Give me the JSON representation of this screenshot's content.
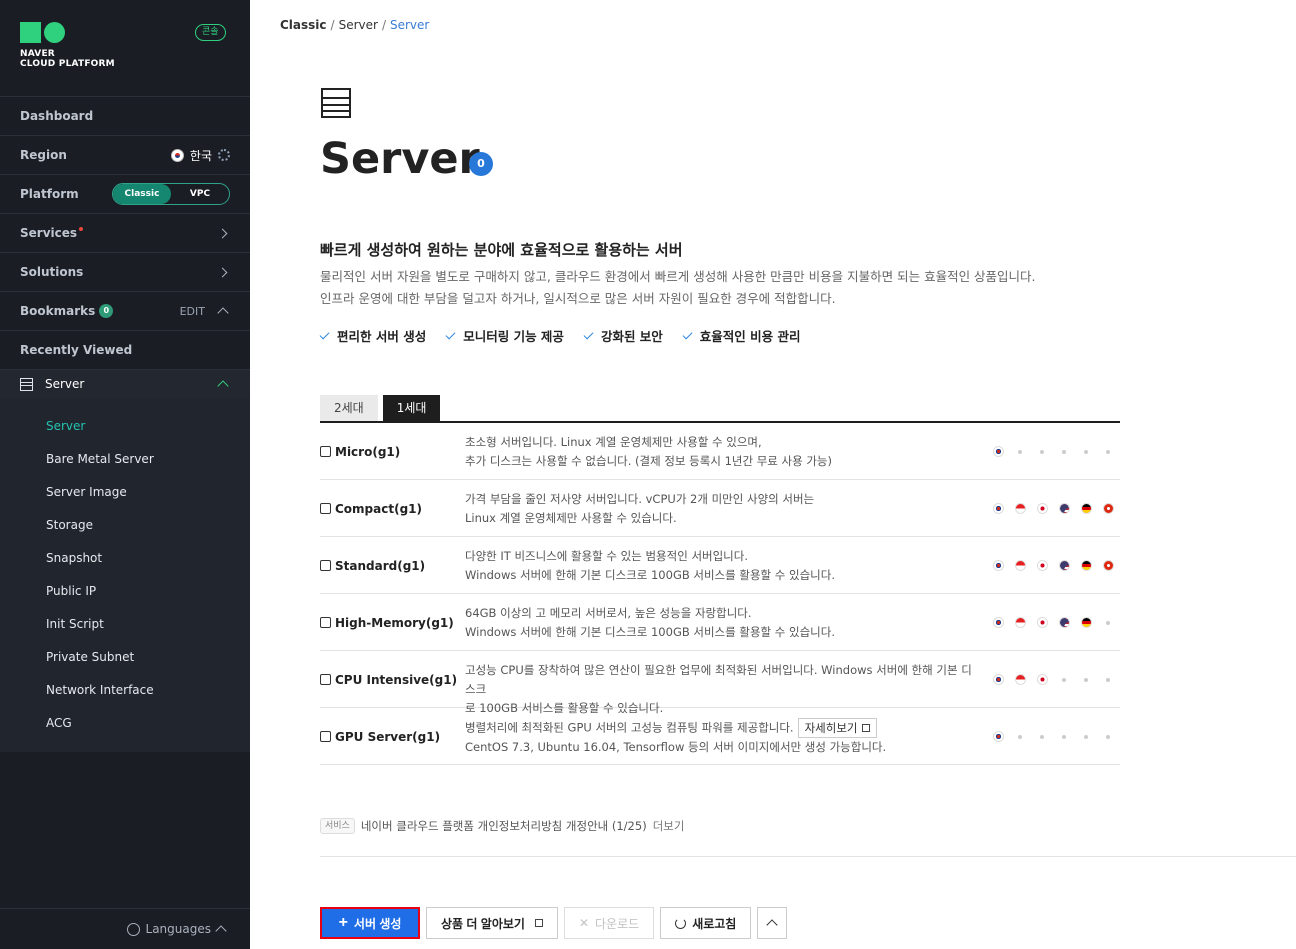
{
  "sidebar": {
    "logo_lines": [
      "NAVER",
      "CLOUD PLATFORM"
    ],
    "console_badge": "콘솔",
    "dashboard": "Dashboard",
    "region": {
      "label": "Region",
      "value": "한국"
    },
    "platform": {
      "label": "Platform",
      "options": [
        "Classic",
        "VPC"
      ],
      "selected": "Classic"
    },
    "services": "Services",
    "solutions": "Solutions",
    "bookmarks": {
      "label": "Bookmarks",
      "count": "0",
      "edit": "EDIT"
    },
    "recently_viewed": "Recently Viewed",
    "server_section": "Server",
    "submenu": [
      "Server",
      "Bare Metal Server",
      "Server Image",
      "Storage",
      "Snapshot",
      "Public IP",
      "Init Script",
      "Private Subnet",
      "Network Interface",
      "ACG"
    ],
    "active_submenu": "Server",
    "languages": "Languages"
  },
  "breadcrumb": [
    "Classic",
    "Server",
    "Server"
  ],
  "header": {
    "title": "Server",
    "count": "0"
  },
  "intro": {
    "headline": "빠르게 생성하여 원하는 분야에 효율적으로 활용하는 서버",
    "lines": [
      "물리적인 서버 자원을 별도로 구매하지 않고, 클라우드 환경에서 빠르게 생성해 사용한 만큼만 비용을 지불하면 되는 효율적인 상품입니다.",
      "인프라 운영에 대한 부담을 덜고자 하거나, 일시적으로 많은 서버 자원이 필요한 경우에 적합합니다."
    ],
    "features": [
      "편리한 서버 생성",
      "모니터링 기능 제공",
      "강화된 보안",
      "효율적인 비용 관리"
    ]
  },
  "tabs": [
    "2세대",
    "1세대"
  ],
  "active_tab": "1세대",
  "products": [
    {
      "name": "Micro(g1)",
      "lines": [
        "초소형 서버입니다. Linux 계열 운영체제만 사용할 수 있으며,",
        "추가 디스크는 사용할 수 없습니다. (결제 정보 등록시 1년간 무료 사용 가능)"
      ],
      "regions": [
        "kr",
        "none",
        "none",
        "none",
        "none",
        "none"
      ]
    },
    {
      "name": "Compact(g1)",
      "lines": [
        "가격 부담을 줄인 저사양 서버입니다. vCPU가 2개 미만인 사양의 서버는",
        "Linux 계열 운영체제만 사용할 수 있습니다."
      ],
      "regions": [
        "kr",
        "sg",
        "jp",
        "us",
        "de",
        "hk"
      ]
    },
    {
      "name": "Standard(g1)",
      "lines": [
        "다양한 IT 비즈니스에 활용할 수 있는 범용적인 서버입니다.",
        "Windows 서버에 한해 기본 디스크로 100GB 서비스를 활용할 수 있습니다."
      ],
      "regions": [
        "kr",
        "sg",
        "jp",
        "us",
        "de",
        "hk"
      ]
    },
    {
      "name": "High-Memory(g1)",
      "lines": [
        "64GB 이상의 고 메모리 서버로서, 높은 성능을 자랑합니다.",
        "Windows 서버에 한해 기본 디스크로 100GB 서비스를 활용할 수 있습니다."
      ],
      "regions": [
        "kr",
        "sg",
        "jp",
        "us",
        "de",
        "none"
      ]
    },
    {
      "name": "CPU Intensive(g1)",
      "lines": [
        "고성능 CPU를 장착하여 많은 연산이 필요한 업무에 최적화된 서버입니다. Windows 서버에 한해 기본 디스크",
        "로 100GB 서비스를 활용할 수 있습니다."
      ],
      "regions": [
        "kr",
        "sg",
        "jp",
        "none",
        "none",
        "none"
      ]
    },
    {
      "name": "GPU Server(g1)",
      "lines": [
        "병렬처리에 최적화된 GPU 서버의 고성능 컴퓨팅 파워를 제공합니다.",
        "CentOS 7.3, Ubuntu 16.04, Tensorflow 등의 서버 이미지에서만 생성 가능합니다."
      ],
      "detail_button": "자세히보기",
      "regions": [
        "kr",
        "none",
        "none",
        "none",
        "none",
        "none"
      ]
    }
  ],
  "notice": {
    "tag": "서비스",
    "text": "네이버 클라우드 플랫폼 개인정보처리방침 개정안내 (1/25)",
    "more": "더보기"
  },
  "actions": {
    "create": "서버 생성",
    "learn_more": "상품 더 알아보기",
    "download": "다운로드",
    "refresh": "새로고침"
  }
}
